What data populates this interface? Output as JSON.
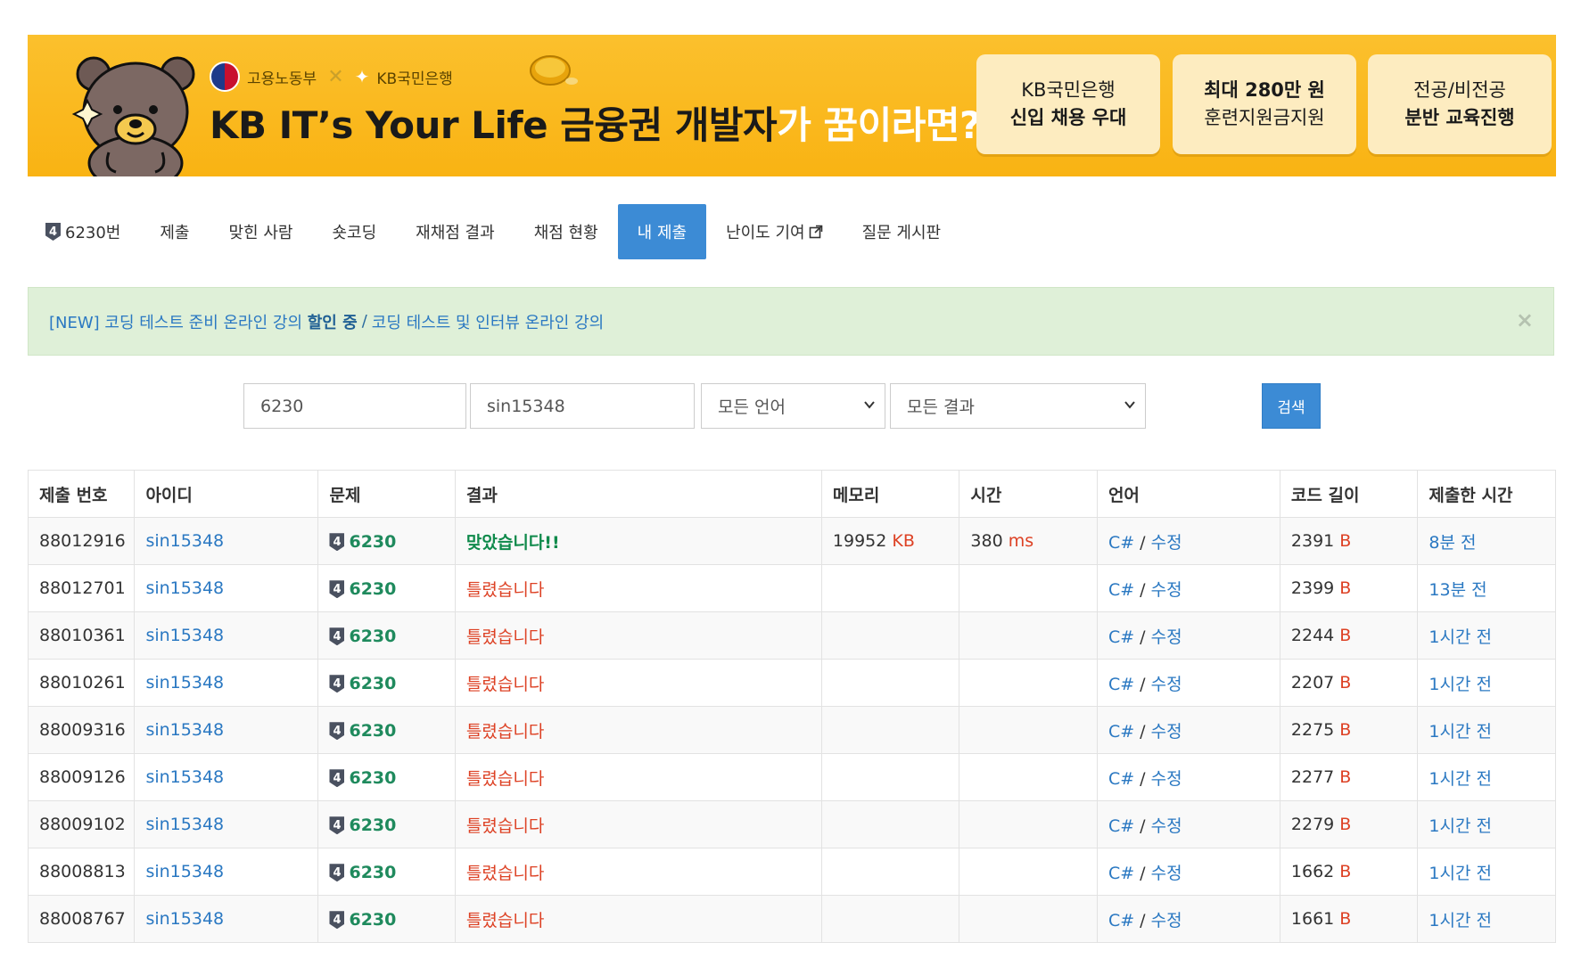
{
  "banner": {
    "logo_gov": "고용노동부",
    "logo_x": "✕",
    "logo_kb": "KB국민은행",
    "headline_dark": "KB IT’s Your Life 금융권 개발자",
    "headline_light": "가 꿈이라면?",
    "pills": [
      {
        "line1": "KB국민은행",
        "line2": "신입 채용 우대"
      },
      {
        "line1": "최대 280만 원",
        "line2": "훈련지원금지원"
      },
      {
        "line1": "전공/비전공",
        "line2": "분반 교육진행"
      }
    ]
  },
  "nav": {
    "tier": "4",
    "problem": "6230번",
    "items": [
      "제출",
      "맞힌 사람",
      "숏코딩",
      "재채점 결과",
      "채점 현황",
      "내 제출",
      "난이도 기여",
      "질문 게시판"
    ]
  },
  "alert": {
    "part1": "[NEW] 코딩 테스트 준비 온라인 강의 ",
    "highlight": "할인 중",
    "separator": "/",
    "part2": "코딩 테스트 및 인터뷰 온라인 강의",
    "close": "×"
  },
  "search": {
    "problem_id": "6230",
    "user_id": "sin15348",
    "language": "모든 언어",
    "result": "모든 결과",
    "button": "검색"
  },
  "table": {
    "headers": [
      "제출 번호",
      "아이디",
      "문제",
      "결과",
      "메모리",
      "시간",
      "언어",
      "코드 길이",
      "제출한 시간"
    ],
    "rows": [
      {
        "id": "88012916",
        "user": "sin15348",
        "tier": "4",
        "problem": "6230",
        "result": "맞았습니다!!",
        "ac": true,
        "memory": "19952",
        "memory_unit": "KB",
        "time": "380",
        "time_unit": "ms",
        "lang": "C#",
        "edit": "수정",
        "length": "2391",
        "length_unit": "B",
        "when": "8분 전"
      },
      {
        "id": "88012701",
        "user": "sin15348",
        "tier": "4",
        "problem": "6230",
        "result": "틀렸습니다",
        "ac": false,
        "memory": "",
        "memory_unit": "",
        "time": "",
        "time_unit": "",
        "lang": "C#",
        "edit": "수정",
        "length": "2399",
        "length_unit": "B",
        "when": "13분 전"
      },
      {
        "id": "88010361",
        "user": "sin15348",
        "tier": "4",
        "problem": "6230",
        "result": "틀렸습니다",
        "ac": false,
        "memory": "",
        "memory_unit": "",
        "time": "",
        "time_unit": "",
        "lang": "C#",
        "edit": "수정",
        "length": "2244",
        "length_unit": "B",
        "when": "1시간 전"
      },
      {
        "id": "88010261",
        "user": "sin15348",
        "tier": "4",
        "problem": "6230",
        "result": "틀렸습니다",
        "ac": false,
        "memory": "",
        "memory_unit": "",
        "time": "",
        "time_unit": "",
        "lang": "C#",
        "edit": "수정",
        "length": "2207",
        "length_unit": "B",
        "when": "1시간 전"
      },
      {
        "id": "88009316",
        "user": "sin15348",
        "tier": "4",
        "problem": "6230",
        "result": "틀렸습니다",
        "ac": false,
        "memory": "",
        "memory_unit": "",
        "time": "",
        "time_unit": "",
        "lang": "C#",
        "edit": "수정",
        "length": "2275",
        "length_unit": "B",
        "when": "1시간 전"
      },
      {
        "id": "88009126",
        "user": "sin15348",
        "tier": "4",
        "problem": "6230",
        "result": "틀렸습니다",
        "ac": false,
        "memory": "",
        "memory_unit": "",
        "time": "",
        "time_unit": "",
        "lang": "C#",
        "edit": "수정",
        "length": "2277",
        "length_unit": "B",
        "when": "1시간 전"
      },
      {
        "id": "88009102",
        "user": "sin15348",
        "tier": "4",
        "problem": "6230",
        "result": "틀렸습니다",
        "ac": false,
        "memory": "",
        "memory_unit": "",
        "time": "",
        "time_unit": "",
        "lang": "C#",
        "edit": "수정",
        "length": "2279",
        "length_unit": "B",
        "when": "1시간 전"
      },
      {
        "id": "88008813",
        "user": "sin15348",
        "tier": "4",
        "problem": "6230",
        "result": "틀렸습니다",
        "ac": false,
        "memory": "",
        "memory_unit": "",
        "time": "",
        "time_unit": "",
        "lang": "C#",
        "edit": "수정",
        "length": "1662",
        "length_unit": "B",
        "when": "1시간 전"
      },
      {
        "id": "88008767",
        "user": "sin15348",
        "tier": "4",
        "problem": "6230",
        "result": "틀렸습니다",
        "ac": false,
        "memory": "",
        "memory_unit": "",
        "time": "",
        "time_unit": "",
        "lang": "C#",
        "edit": "수정",
        "length": "1661",
        "length_unit": "B",
        "when": "1시간 전"
      }
    ]
  }
}
